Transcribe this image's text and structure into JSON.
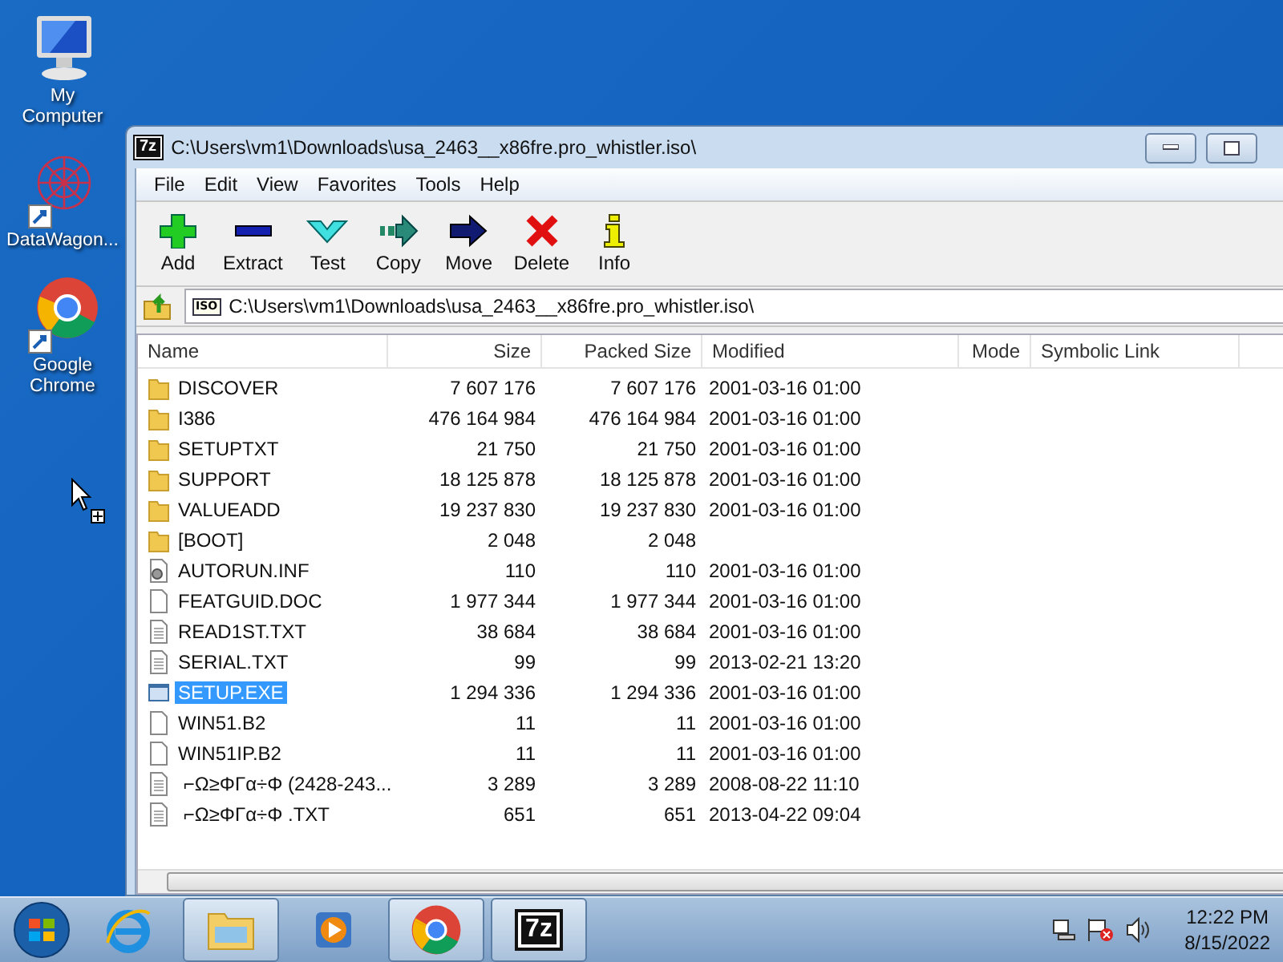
{
  "desktop_icons": [
    {
      "label": "My\nComputer",
      "kind": "computer"
    },
    {
      "label": "DataWagon...",
      "kind": "web"
    },
    {
      "label": "Google\nChrome",
      "kind": "chrome"
    }
  ],
  "window": {
    "badge": "7z",
    "title": "C:\\Users\\vm1\\Downloads\\usa_2463__x86fre.pro_whistler.iso\\"
  },
  "menu": [
    "File",
    "Edit",
    "View",
    "Favorites",
    "Tools",
    "Help"
  ],
  "toolbar": [
    {
      "label": "Add",
      "kind": "add"
    },
    {
      "label": "Extract",
      "kind": "extract"
    },
    {
      "label": "Test",
      "kind": "test"
    },
    {
      "label": "Copy",
      "kind": "copy"
    },
    {
      "label": "Move",
      "kind": "move"
    },
    {
      "label": "Delete",
      "kind": "delete"
    },
    {
      "label": "Info",
      "kind": "info"
    }
  ],
  "address": {
    "badge": "ISO",
    "path": "C:\\Users\\vm1\\Downloads\\usa_2463__x86fre.pro_whistler.iso\\"
  },
  "columns": [
    "Name",
    "Size",
    "Packed Size",
    "Modified",
    "Mode",
    "Symbolic Link"
  ],
  "rows": [
    {
      "name": "DISCOVER",
      "size": "7 607 176",
      "packed": "7 607 176",
      "modified": "2001-03-16 01:00",
      "kind": "folder",
      "selected": false
    },
    {
      "name": "I386",
      "size": "476 164 984",
      "packed": "476 164 984",
      "modified": "2001-03-16 01:00",
      "kind": "folder",
      "selected": false
    },
    {
      "name": "SETUPTXT",
      "size": "21 750",
      "packed": "21 750",
      "modified": "2001-03-16 01:00",
      "kind": "folder",
      "selected": false
    },
    {
      "name": "SUPPORT",
      "size": "18 125 878",
      "packed": "18 125 878",
      "modified": "2001-03-16 01:00",
      "kind": "folder",
      "selected": false
    },
    {
      "name": "VALUEADD",
      "size": "19 237 830",
      "packed": "19 237 830",
      "modified": "2001-03-16 01:00",
      "kind": "folder",
      "selected": false
    },
    {
      "name": "[BOOT]",
      "size": "2 048",
      "packed": "2 048",
      "kind": "folder",
      "selected": false
    },
    {
      "name": "AUTORUN.INF",
      "size": "110",
      "packed": "110",
      "modified": "2001-03-16 01:00",
      "kind": "settings",
      "selected": false
    },
    {
      "name": "FEATGUID.DOC",
      "size": "1 977 344",
      "packed": "1 977 344",
      "modified": "2001-03-16 01:00",
      "kind": "file",
      "selected": false
    },
    {
      "name": "READ1ST.TXT",
      "size": "38 684",
      "packed": "38 684",
      "modified": "2001-03-16 01:00",
      "kind": "text",
      "selected": false
    },
    {
      "name": "SERIAL.TXT",
      "size": "99",
      "packed": "99",
      "modified": "2013-02-21 13:20",
      "kind": "text",
      "selected": false
    },
    {
      "name": "SETUP.EXE",
      "size": "1 294 336",
      "packed": "1 294 336",
      "modified": "2001-03-16 01:00",
      "kind": "exe",
      "selected": true
    },
    {
      "name": "WIN51.B2",
      "size": "11",
      "packed": "11",
      "modified": "2001-03-16 01:00",
      "kind": "file",
      "selected": false
    },
    {
      "name": "WIN51IP.B2",
      "size": "11",
      "packed": "11",
      "modified": "2001-03-16 01:00",
      "kind": "file",
      "selected": false
    },
    {
      "name": " ⌐Ω≥ΦΓα÷Φ (2428-243...",
      "size": "3 289",
      "packed": "3 289",
      "modified": "2008-08-22 11:10",
      "kind": "text",
      "selected": false
    },
    {
      "name": " ⌐Ω≥ΦΓα÷Φ .TXT",
      "size": "651",
      "packed": "651",
      "modified": "2013-04-22 09:04",
      "kind": "text",
      "selected": false
    }
  ],
  "taskbar": [
    {
      "kind": "ie",
      "selected": false
    },
    {
      "kind": "explorer",
      "selected": true
    },
    {
      "kind": "media",
      "selected": false
    },
    {
      "kind": "chrome",
      "selected": true
    },
    {
      "kind": "sevenzip",
      "label": "7z",
      "selected": true
    }
  ],
  "clock": {
    "time": "12:22 PM",
    "date": "8/15/2022"
  }
}
